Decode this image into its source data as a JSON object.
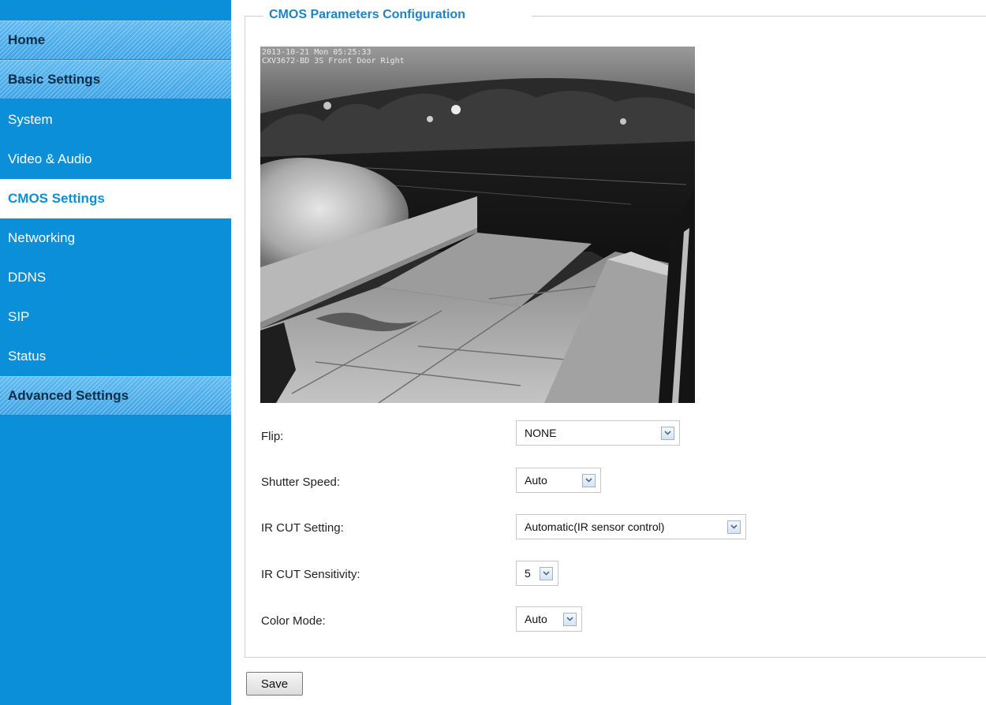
{
  "sidebar": {
    "items": [
      {
        "label": "Home",
        "kind": "section"
      },
      {
        "label": "Basic Settings",
        "kind": "section"
      },
      {
        "label": "System",
        "kind": "item"
      },
      {
        "label": "Video & Audio",
        "kind": "item"
      },
      {
        "label": "CMOS Settings",
        "kind": "active"
      },
      {
        "label": "Networking",
        "kind": "item"
      },
      {
        "label": "DDNS",
        "kind": "item"
      },
      {
        "label": "SIP",
        "kind": "item"
      },
      {
        "label": "Status",
        "kind": "item"
      },
      {
        "label": "Advanced Settings",
        "kind": "section"
      }
    ]
  },
  "main": {
    "legend": "CMOS Parameters Configuration",
    "camera": {
      "overlay_line1": "2013-10-21 Mon 05:25:33",
      "overlay_line2": "CXV3672-BD 3S Front Door Right"
    },
    "form": {
      "flip": {
        "label": "Flip:",
        "value": "NONE"
      },
      "shutter_speed": {
        "label": "Shutter Speed:",
        "value": "Auto"
      },
      "ir_cut_setting": {
        "label": "IR CUT Setting:",
        "value": "Automatic(IR sensor control)"
      },
      "ir_cut_sensitivity": {
        "label": "IR CUT Sensitivity:",
        "value": "5"
      },
      "color_mode": {
        "label": "Color Mode:",
        "value": "Auto"
      }
    },
    "save_label": "Save"
  },
  "colors": {
    "sidebar_bg": "#0a8fd8",
    "section_bg": "#4aaceb",
    "active_text": "#0a8fd8",
    "legend_text": "#1b84c7"
  },
  "icons": {
    "dropdown": "chevron-down-icon"
  }
}
